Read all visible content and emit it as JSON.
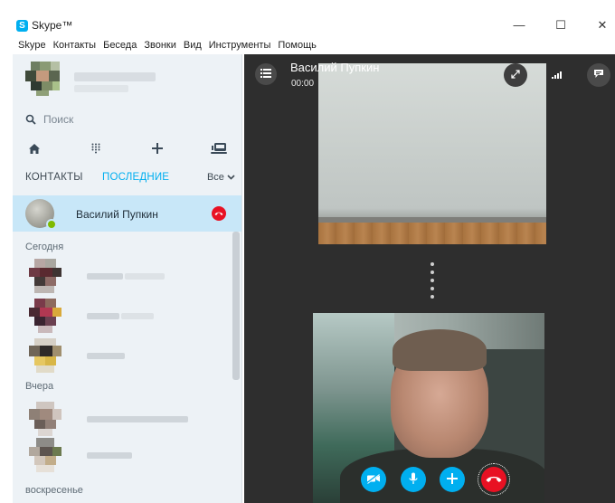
{
  "window": {
    "title": "Skype™",
    "logo_letter": "S",
    "controls": {
      "minimize": "—",
      "maximize": "☐",
      "close": "✕"
    }
  },
  "menu": [
    "Skype",
    "Контакты",
    "Беседа",
    "Звонки",
    "Вид",
    "Инструменты",
    "Помощь"
  ],
  "sidebar": {
    "search_label": "Поиск",
    "tabs": {
      "contacts": "КОНТАКТЫ",
      "recent": "ПОСЛЕДНИЕ"
    },
    "filter_label": "Все",
    "active_contact": {
      "name": "Василий Пупкин",
      "status": "online"
    },
    "sections": {
      "today": "Сегодня",
      "yesterday": "Вчера",
      "sunday": "воскресенье"
    }
  },
  "call": {
    "caller_name": "Василий Пупкин",
    "timer": "00:00"
  },
  "colors": {
    "accent": "#00aff0",
    "end_call": "#e81123",
    "online": "#7fba00",
    "active_row": "#c8e7f8",
    "sidebar_bg": "#edf2f6",
    "call_bg": "#2e2e2e"
  },
  "icons": {
    "menu": "list-icon",
    "search": "search-icon",
    "home": "home-icon",
    "dialpad": "dialpad-icon",
    "add": "plus-icon",
    "bot": "bot-icon",
    "expand": "expand-icon",
    "signal": "signal-icon",
    "chat": "chat-icon",
    "video_off": "video-off-icon",
    "mic": "microphone-icon",
    "hangup": "hangup-icon"
  }
}
